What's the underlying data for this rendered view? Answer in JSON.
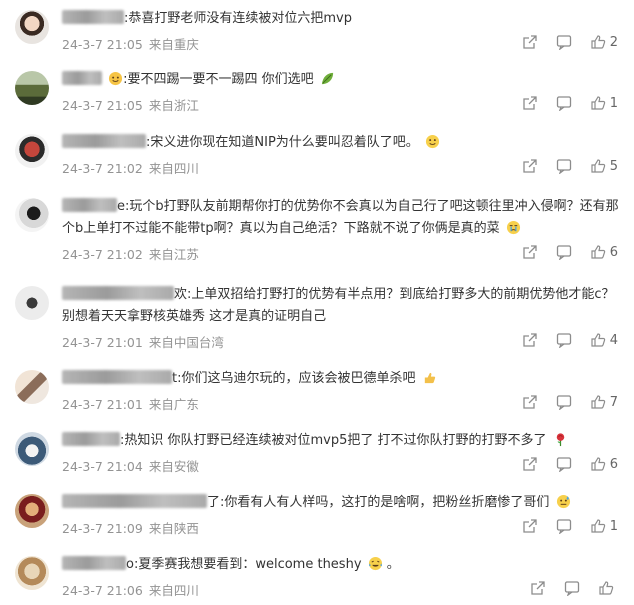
{
  "comments": [
    {
      "text": ":恭喜打野老师没有连续被对位六把mvp",
      "date": "24-3-7 21:05",
      "location": "来自重庆",
      "likes": "2",
      "emoji": ""
    },
    {
      "text": ":要不四踢一要不一踢四 你们选吧",
      "date": "24-3-7 21:05",
      "location": "来自浙江",
      "likes": "1",
      "emoji": "leaf"
    },
    {
      "text": ":宋义进你现在知道NIP为什么要叫忍着队了吧。",
      "date": "24-3-7 21:02",
      "location": "来自四川",
      "likes": "5",
      "emoji": "smile"
    },
    {
      "text": "e:玩个b打野队友前期帮你打的优势你不会真以为自己行了吧这顿往里冲入侵啊？还有那个b上单打不过能不能带tp啊？真以为自己绝活？下路就不说了你俩是真的菜",
      "date": "24-3-7 21:02",
      "location": "来自江苏",
      "likes": "6",
      "emoji": "cry"
    },
    {
      "text": "欢:上单双招给打野打的优势有半点用？到底给打野多大的前期优势他才能c？别想着天天拿野核英雄秀 这才是真的证明自己",
      "date": "24-3-7 21:01",
      "location": "来自中国台湾",
      "likes": "4",
      "emoji": ""
    },
    {
      "text": "t:你们这乌迪尔玩的，应该会被巴德单杀吧",
      "date": "24-3-7 21:01",
      "location": "来自广东",
      "likes": "7",
      "emoji": "thumb"
    },
    {
      "text": ":热知识 你队打野已经连续被对位mvp5把了 打不过你队打野的打野不多了",
      "date": "24-3-7 21:04",
      "location": "来自安徽",
      "likes": "6",
      "emoji": "rose"
    },
    {
      "text": "了:你看有人有人样吗，这打的是啥啊，把粉丝折磨惨了哥们",
      "date": "24-3-7 21:09",
      "location": "来自陕西",
      "likes": "1",
      "emoji": "sweat"
    },
    {
      "text": "o:夏季赛我想要看到：welcome theshy",
      "date": "24-3-7 21:06",
      "location": "来自四川",
      "likes": "",
      "emoji": "laughcry"
    }
  ]
}
